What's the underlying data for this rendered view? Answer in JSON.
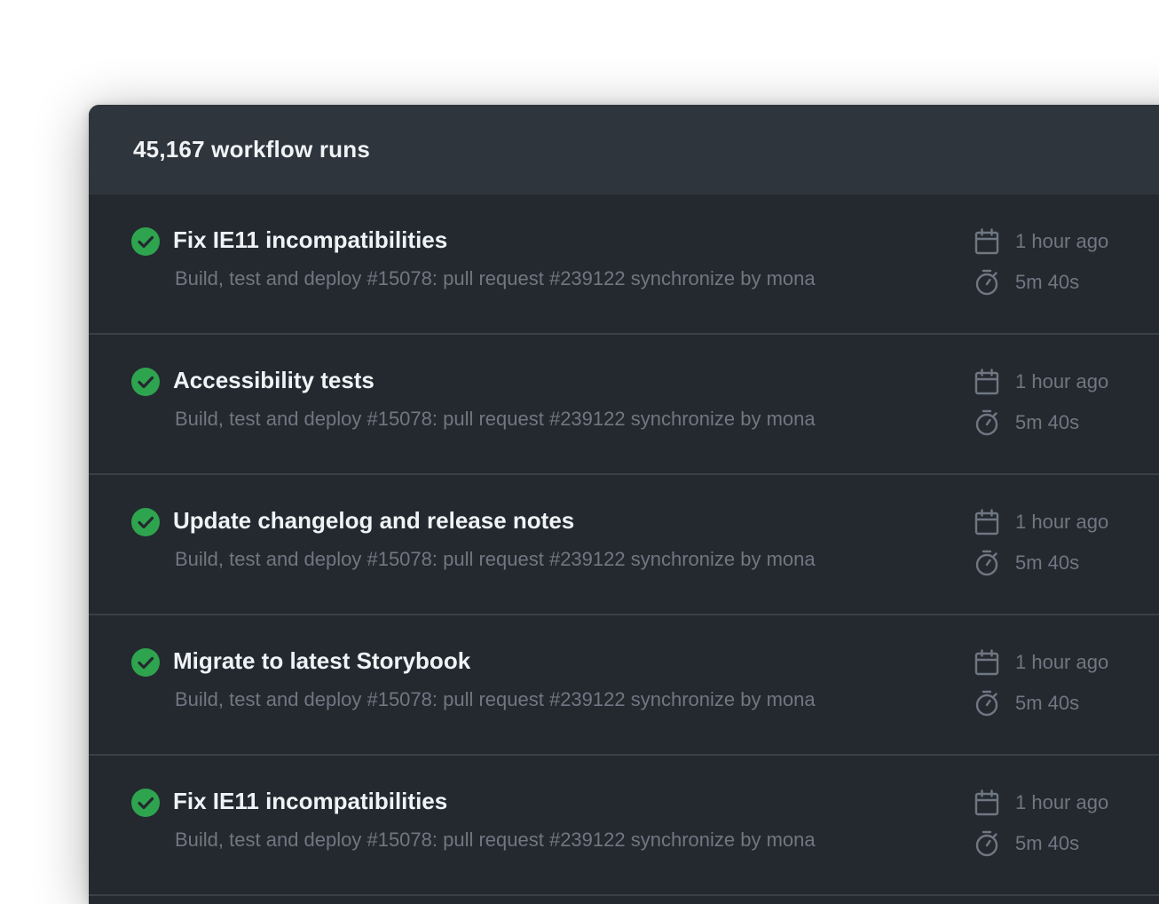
{
  "header": {
    "title": "45,167 workflow runs"
  },
  "runs": [
    {
      "status": "success",
      "status_icon": "check-circle-icon",
      "title": "Fix IE11 incompatibilities",
      "subtitle": "Build, test and deploy #15078: pull request #239122 synchronize by mona",
      "time": "1 hour ago",
      "time_icon": "calendar-icon",
      "duration": "5m 40s",
      "duration_icon": "stopwatch-icon"
    },
    {
      "status": "success",
      "status_icon": "check-circle-icon",
      "title": "Accessibility tests",
      "subtitle": "Build, test and deploy #15078: pull request #239122 synchronize by mona",
      "time": "1 hour ago",
      "time_icon": "calendar-icon",
      "duration": "5m 40s",
      "duration_icon": "stopwatch-icon"
    },
    {
      "status": "success",
      "status_icon": "check-circle-icon",
      "title": "Update changelog and release notes",
      "subtitle": "Build, test and deploy #15078: pull request #239122 synchronize by mona",
      "time": "1 hour ago",
      "time_icon": "calendar-icon",
      "duration": "5m 40s",
      "duration_icon": "stopwatch-icon"
    },
    {
      "status": "success",
      "status_icon": "check-circle-icon",
      "title": "Migrate to latest Storybook",
      "subtitle": "Build, test and deploy #15078: pull request #239122 synchronize by mona",
      "time": "1 hour ago",
      "time_icon": "calendar-icon",
      "duration": "5m 40s",
      "duration_icon": "stopwatch-icon"
    },
    {
      "status": "success",
      "status_icon": "check-circle-icon",
      "title": "Fix IE11 incompatibilities",
      "subtitle": "Build, test and deploy #15078: pull request #239122 synchronize by mona",
      "time": "1 hour ago",
      "time_icon": "calendar-icon",
      "duration": "5m 40s",
      "duration_icon": "stopwatch-icon"
    }
  ],
  "colors": {
    "panel_bg": "#24292f",
    "header_bg": "#2f353c",
    "success": "#2ea44f",
    "title_text": "#f0f3f6",
    "muted_text": "#6f7782",
    "divider": "#3a4048"
  }
}
